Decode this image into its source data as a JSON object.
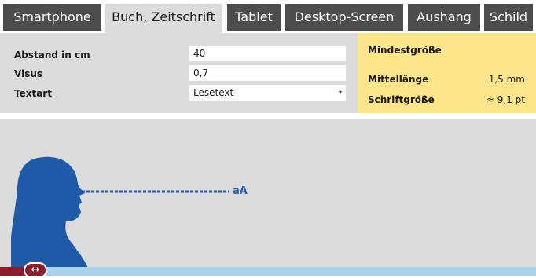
{
  "tabs": [
    {
      "label": "Smartphone",
      "active": false
    },
    {
      "label": "Buch, Zeitschrift",
      "active": true
    },
    {
      "label": "Tablet",
      "active": false
    },
    {
      "label": "Desktop-Screen",
      "active": false
    },
    {
      "label": "Aushang",
      "active": false
    },
    {
      "label": "Schild",
      "active": false
    }
  ],
  "form": {
    "distance_label": "Abstand in cm",
    "distance_value": "40",
    "visus_label": "Visus",
    "visus_value": "0,7",
    "texttype_label": "Textart",
    "texttype_value": "Lesetext"
  },
  "result": {
    "title": "Mindestgröße",
    "midlength_label": "Mittellänge",
    "midlength_value": "1,5 mm",
    "fontsize_label": "Schriftgröße",
    "fontsize_value": "≈ 9,1 pt"
  },
  "scene": {
    "sample_text": "aA",
    "handle_icon": "↔"
  },
  "colors": {
    "tab_bg": "#4d4d4d",
    "panel_bg": "#dcdcdc",
    "result_bg": "#fde68a",
    "silhouette": "#1e5aa8",
    "floor": "#a7d3ec",
    "accent": "#8b1e2d"
  }
}
